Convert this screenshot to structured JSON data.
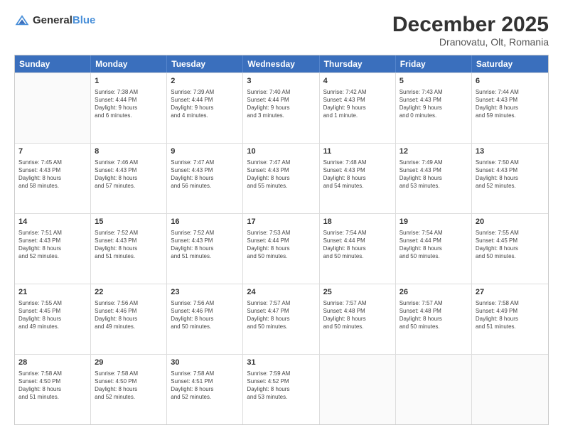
{
  "logo": {
    "text_general": "General",
    "text_blue": "Blue"
  },
  "title": "December 2025",
  "subtitle": "Dranovatu, Olt, Romania",
  "weekdays": [
    "Sunday",
    "Monday",
    "Tuesday",
    "Wednesday",
    "Thursday",
    "Friday",
    "Saturday"
  ],
  "rows": [
    [
      {
        "day": "",
        "info": ""
      },
      {
        "day": "1",
        "info": "Sunrise: 7:38 AM\nSunset: 4:44 PM\nDaylight: 9 hours\nand 6 minutes."
      },
      {
        "day": "2",
        "info": "Sunrise: 7:39 AM\nSunset: 4:44 PM\nDaylight: 9 hours\nand 4 minutes."
      },
      {
        "day": "3",
        "info": "Sunrise: 7:40 AM\nSunset: 4:44 PM\nDaylight: 9 hours\nand 3 minutes."
      },
      {
        "day": "4",
        "info": "Sunrise: 7:42 AM\nSunset: 4:43 PM\nDaylight: 9 hours\nand 1 minute."
      },
      {
        "day": "5",
        "info": "Sunrise: 7:43 AM\nSunset: 4:43 PM\nDaylight: 9 hours\nand 0 minutes."
      },
      {
        "day": "6",
        "info": "Sunrise: 7:44 AM\nSunset: 4:43 PM\nDaylight: 8 hours\nand 59 minutes."
      }
    ],
    [
      {
        "day": "7",
        "info": "Sunrise: 7:45 AM\nSunset: 4:43 PM\nDaylight: 8 hours\nand 58 minutes."
      },
      {
        "day": "8",
        "info": "Sunrise: 7:46 AM\nSunset: 4:43 PM\nDaylight: 8 hours\nand 57 minutes."
      },
      {
        "day": "9",
        "info": "Sunrise: 7:47 AM\nSunset: 4:43 PM\nDaylight: 8 hours\nand 56 minutes."
      },
      {
        "day": "10",
        "info": "Sunrise: 7:47 AM\nSunset: 4:43 PM\nDaylight: 8 hours\nand 55 minutes."
      },
      {
        "day": "11",
        "info": "Sunrise: 7:48 AM\nSunset: 4:43 PM\nDaylight: 8 hours\nand 54 minutes."
      },
      {
        "day": "12",
        "info": "Sunrise: 7:49 AM\nSunset: 4:43 PM\nDaylight: 8 hours\nand 53 minutes."
      },
      {
        "day": "13",
        "info": "Sunrise: 7:50 AM\nSunset: 4:43 PM\nDaylight: 8 hours\nand 52 minutes."
      }
    ],
    [
      {
        "day": "14",
        "info": "Sunrise: 7:51 AM\nSunset: 4:43 PM\nDaylight: 8 hours\nand 52 minutes."
      },
      {
        "day": "15",
        "info": "Sunrise: 7:52 AM\nSunset: 4:43 PM\nDaylight: 8 hours\nand 51 minutes."
      },
      {
        "day": "16",
        "info": "Sunrise: 7:52 AM\nSunset: 4:43 PM\nDaylight: 8 hours\nand 51 minutes."
      },
      {
        "day": "17",
        "info": "Sunrise: 7:53 AM\nSunset: 4:44 PM\nDaylight: 8 hours\nand 50 minutes."
      },
      {
        "day": "18",
        "info": "Sunrise: 7:54 AM\nSunset: 4:44 PM\nDaylight: 8 hours\nand 50 minutes."
      },
      {
        "day": "19",
        "info": "Sunrise: 7:54 AM\nSunset: 4:44 PM\nDaylight: 8 hours\nand 50 minutes."
      },
      {
        "day": "20",
        "info": "Sunrise: 7:55 AM\nSunset: 4:45 PM\nDaylight: 8 hours\nand 50 minutes."
      }
    ],
    [
      {
        "day": "21",
        "info": "Sunrise: 7:55 AM\nSunset: 4:45 PM\nDaylight: 8 hours\nand 49 minutes."
      },
      {
        "day": "22",
        "info": "Sunrise: 7:56 AM\nSunset: 4:46 PM\nDaylight: 8 hours\nand 49 minutes."
      },
      {
        "day": "23",
        "info": "Sunrise: 7:56 AM\nSunset: 4:46 PM\nDaylight: 8 hours\nand 50 minutes."
      },
      {
        "day": "24",
        "info": "Sunrise: 7:57 AM\nSunset: 4:47 PM\nDaylight: 8 hours\nand 50 minutes."
      },
      {
        "day": "25",
        "info": "Sunrise: 7:57 AM\nSunset: 4:48 PM\nDaylight: 8 hours\nand 50 minutes."
      },
      {
        "day": "26",
        "info": "Sunrise: 7:57 AM\nSunset: 4:48 PM\nDaylight: 8 hours\nand 50 minutes."
      },
      {
        "day": "27",
        "info": "Sunrise: 7:58 AM\nSunset: 4:49 PM\nDaylight: 8 hours\nand 51 minutes."
      }
    ],
    [
      {
        "day": "28",
        "info": "Sunrise: 7:58 AM\nSunset: 4:50 PM\nDaylight: 8 hours\nand 51 minutes."
      },
      {
        "day": "29",
        "info": "Sunrise: 7:58 AM\nSunset: 4:50 PM\nDaylight: 8 hours\nand 52 minutes."
      },
      {
        "day": "30",
        "info": "Sunrise: 7:58 AM\nSunset: 4:51 PM\nDaylight: 8 hours\nand 52 minutes."
      },
      {
        "day": "31",
        "info": "Sunrise: 7:59 AM\nSunset: 4:52 PM\nDaylight: 8 hours\nand 53 minutes."
      },
      {
        "day": "",
        "info": ""
      },
      {
        "day": "",
        "info": ""
      },
      {
        "day": "",
        "info": ""
      }
    ]
  ]
}
